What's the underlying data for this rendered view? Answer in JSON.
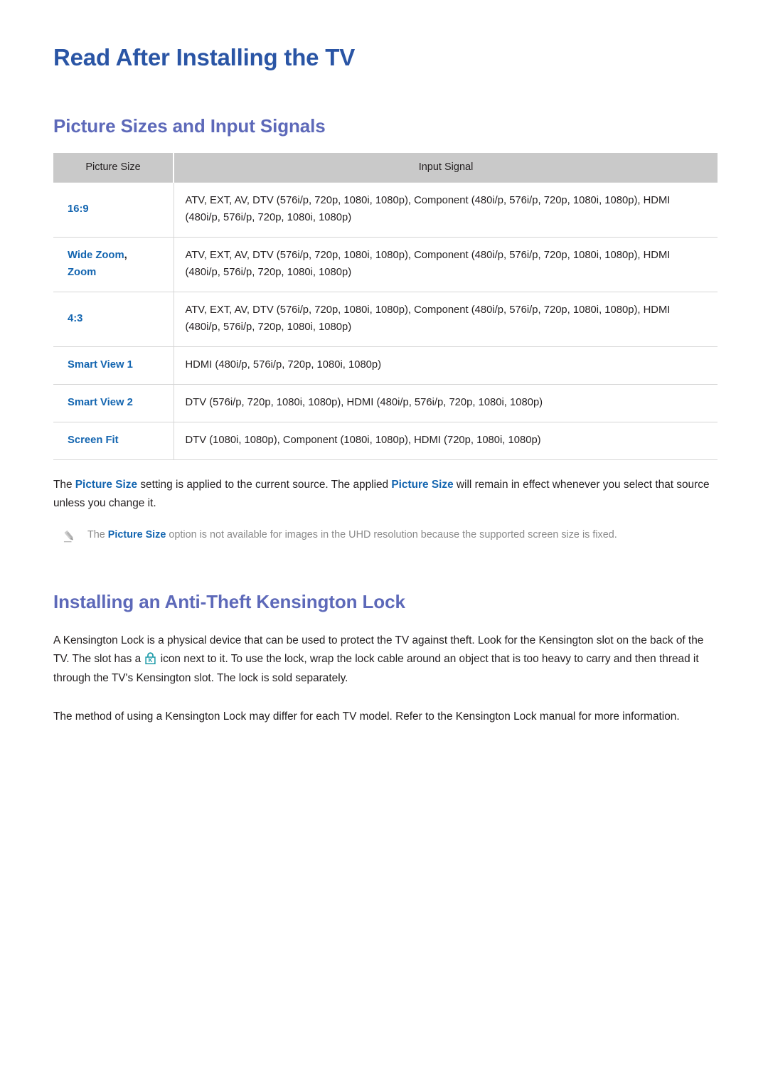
{
  "document": {
    "title": "Read After Installing the TV"
  },
  "sections": [
    {
      "id": "picture-sizes",
      "heading": "Picture Sizes and Input Signals"
    },
    {
      "id": "kensington-lock",
      "heading": "Installing an Anti-Theft Kensington Lock"
    }
  ],
  "table": {
    "headers": [
      "Picture Size",
      "Input Signal"
    ],
    "rows": [
      {
        "label": "16:9",
        "label_suffix": "",
        "label_line2": "",
        "value": "ATV, EXT, AV, DTV (576i/p, 720p, 1080i, 1080p), Component (480i/p, 576i/p, 720p, 1080i, 1080p), HDMI (480i/p, 576i/p, 720p, 1080i, 1080p)"
      },
      {
        "label": "Wide Zoom",
        "label_suffix": ",",
        "label_line2": "Zoom",
        "value": "ATV, EXT, AV, DTV (576i/p, 720p, 1080i, 1080p), Component (480i/p, 576i/p, 720p, 1080i, 1080p), HDMI (480i/p, 576i/p, 720p, 1080i, 1080p)"
      },
      {
        "label": "4:3",
        "label_suffix": "",
        "label_line2": "",
        "value": "ATV, EXT, AV, DTV (576i/p, 720p, 1080i, 1080p), Component (480i/p, 576i/p, 720p, 1080i, 1080p), HDMI (480i/p, 576i/p, 720p, 1080i, 1080p)"
      },
      {
        "label": "Smart View 1",
        "label_suffix": "",
        "label_line2": "",
        "value": "HDMI (480i/p, 576i/p, 720p, 1080i, 1080p)"
      },
      {
        "label": "Smart View 2",
        "label_suffix": "",
        "label_line2": "",
        "value": "DTV (576i/p, 720p, 1080i, 1080p), HDMI (480i/p, 576i/p, 720p, 1080i, 1080p)"
      },
      {
        "label": "Screen Fit",
        "label_suffix": "",
        "label_line2": "",
        "value": "DTV (1080i, 1080p), Component (1080i, 1080p), HDMI (720p, 1080i, 1080p)"
      }
    ]
  },
  "picture_size_paragraph": {
    "part1": "The ",
    "term1": "Picture Size",
    "part2": " setting is applied to the current source. The applied ",
    "term2": "Picture Size",
    "part3": " will remain in effect whenever you select that source unless you change it."
  },
  "note": {
    "icon": "pencil-icon",
    "part1": "The ",
    "term": "Picture Size",
    "part2": " option is not available for images in the UHD resolution because the supported screen size is fixed."
  },
  "kensington": {
    "paragraph1_part1": "A Kensington Lock is a physical device that can be used to protect the TV against theft. Look for the Kensington slot on the back of the TV. The slot has a ",
    "paragraph1_icon": "kensington-lock-icon",
    "paragraph1_part2": " icon next to it. To use the lock, wrap the lock cable around an object that is too heavy to carry and then thread it through the TV's Kensington slot. The lock is sold separately.",
    "paragraph2": "The method of using a Kensington Lock may differ for each TV model. Refer to the Kensington Lock manual for more information."
  },
  "colors": {
    "doc_title": "#2a55a5",
    "section_heading": "#5d69b9",
    "link_blue": "#1365b0",
    "table_header_bg": "#c9c9c9",
    "table_border": "#d6d6d6",
    "note_gray": "#8a8a8a",
    "lock_icon_teal": "#1a9aa8",
    "body_text": "#231f20"
  }
}
